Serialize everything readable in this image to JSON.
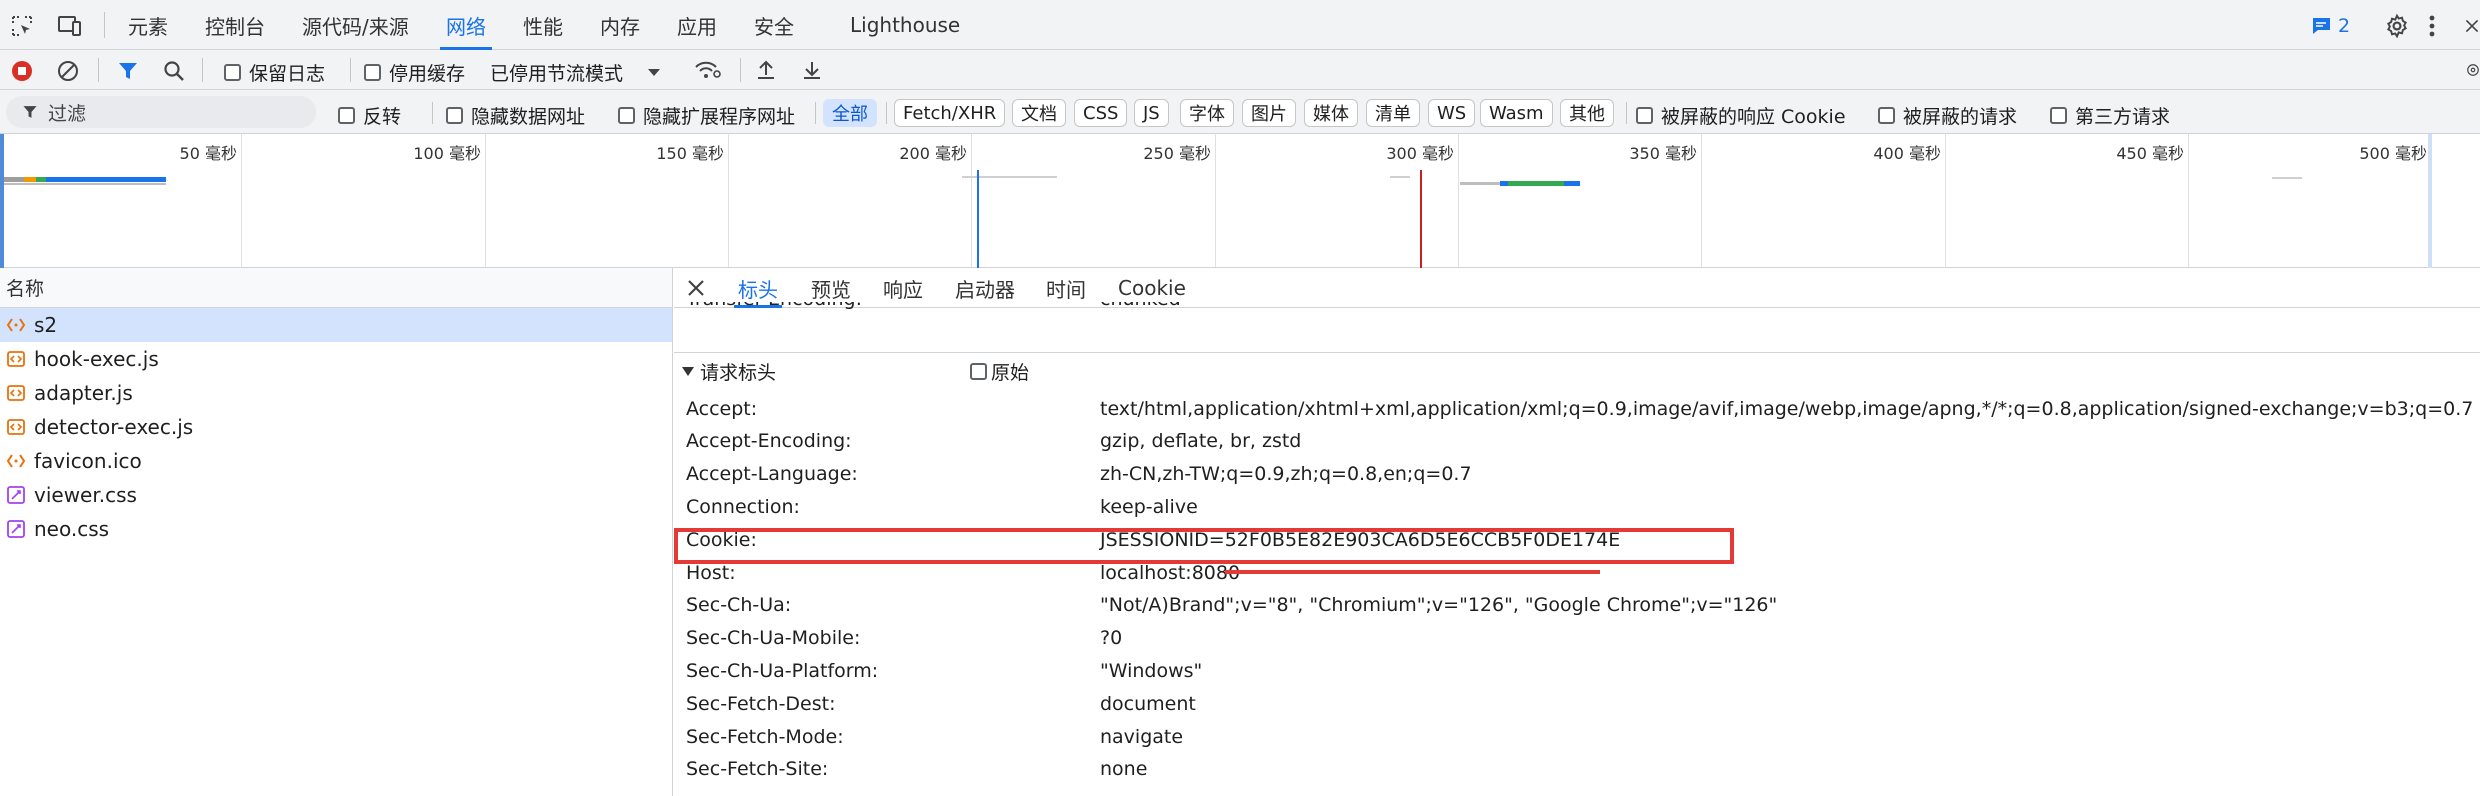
{
  "main_tabs": [
    {
      "label": "元素"
    },
    {
      "label": "控制台"
    },
    {
      "label": "源代码/来源"
    },
    {
      "label": "网络"
    },
    {
      "label": "性能"
    },
    {
      "label": "内存"
    },
    {
      "label": "应用"
    },
    {
      "label": "安全"
    },
    {
      "label": "Lighthouse"
    }
  ],
  "issues_count": "2",
  "toolbar": {
    "preserve_log": "保留日志",
    "disable_cache": "停用缓存",
    "throttling": "已停用节流模式"
  },
  "filter": {
    "placeholder": "过滤",
    "invert": "反转",
    "hide_data_urls": "隐藏数据网址",
    "hide_ext_urls": "隐藏扩展程序网址",
    "types": [
      "全部",
      "Fetch/XHR",
      "文档",
      "CSS",
      "JS",
      "字体",
      "图片",
      "媒体",
      "清单",
      "WS",
      "Wasm",
      "其他"
    ],
    "blocked_cookies": "被屏蔽的响应 Cookie",
    "blocked_requests": "被屏蔽的请求",
    "third_party": "第三方请求"
  },
  "timeline": {
    "ticks": [
      "50 毫秒",
      "100 毫秒",
      "150 毫秒",
      "200 毫秒",
      "250 毫秒",
      "300 毫秒",
      "350 毫秒",
      "400 毫秒",
      "450 毫秒",
      "500 毫秒"
    ]
  },
  "request_list": {
    "header": "名称",
    "items": [
      {
        "name": "s2",
        "kind": "doc"
      },
      {
        "name": "hook-exec.js",
        "kind": "script"
      },
      {
        "name": "adapter.js",
        "kind": "script"
      },
      {
        "name": "detector-exec.js",
        "kind": "script"
      },
      {
        "name": "favicon.ico",
        "kind": "doc"
      },
      {
        "name": "viewer.css",
        "kind": "style"
      },
      {
        "name": "neo.css",
        "kind": "style"
      }
    ]
  },
  "detail_tabs": [
    {
      "label": "标头"
    },
    {
      "label": "预览"
    },
    {
      "label": "响应"
    },
    {
      "label": "启动器"
    },
    {
      "label": "时间"
    },
    {
      "label": "Cookie"
    }
  ],
  "partial_row": {
    "name": "Transfer-Encoding:",
    "value": "chunked"
  },
  "request_headers": {
    "title": "请求标头",
    "raw_label": "原始",
    "rows": [
      {
        "name": "Accept:",
        "value": "text/html,application/xhtml+xml,application/xml;q=0.9,image/avif,image/webp,image/apng,*/*;q=0.8,application/signed-exchange;v=b3;q=0.7"
      },
      {
        "name": "Accept-Encoding:",
        "value": "gzip, deflate, br, zstd"
      },
      {
        "name": "Accept-Language:",
        "value": "zh-CN,zh-TW;q=0.9,zh;q=0.8,en;q=0.7"
      },
      {
        "name": "Connection:",
        "value": "keep-alive"
      },
      {
        "name": "Cookie:",
        "value": "JSESSIONID=52F0B5E82E903CA6D5E6CCB5F0DE174E"
      },
      {
        "name": "Host:",
        "value": "localhost:8080"
      },
      {
        "name": "Sec-Ch-Ua:",
        "value": "\"Not/A)Brand\";v=\"8\", \"Chromium\";v=\"126\", \"Google Chrome\";v=\"126\""
      },
      {
        "name": "Sec-Ch-Ua-Mobile:",
        "value": "?0"
      },
      {
        "name": "Sec-Ch-Ua-Platform:",
        "value": "\"Windows\""
      },
      {
        "name": "Sec-Fetch-Dest:",
        "value": "document"
      },
      {
        "name": "Sec-Fetch-Mode:",
        "value": "navigate"
      },
      {
        "name": "Sec-Fetch-Site:",
        "value": "none"
      }
    ]
  },
  "colors": {
    "accent": "#1a73e8",
    "record_red": "#d93025",
    "highlight": "#e53935"
  }
}
